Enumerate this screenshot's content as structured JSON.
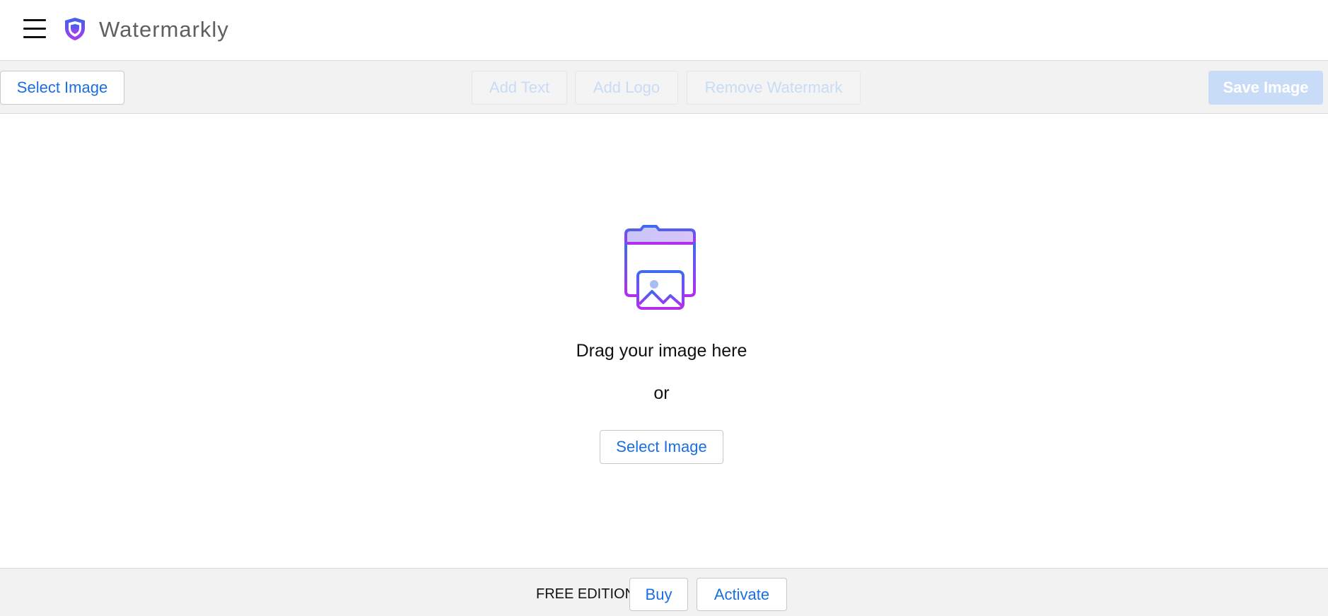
{
  "header": {
    "menu_icon": "hamburger-menu-icon",
    "logo_icon": "shield-logo-icon",
    "app_title": "Watermarkly",
    "colors": {
      "logo_gradient_start": "#4a4ee8",
      "logo_gradient_end": "#a93cf0"
    }
  },
  "toolbar": {
    "select_image_label": "Select Image",
    "add_text_label": "Add Text",
    "add_logo_label": "Add Logo",
    "remove_watermark_label": "Remove Watermark",
    "save_image_label": "Save Image"
  },
  "dropzone": {
    "icon": "folder-image-icon",
    "drag_text": "Drag your image here",
    "or_text": "or",
    "select_image_label": "Select Image"
  },
  "footer": {
    "edition_label": "FREE EDITION",
    "buy_label": "Buy",
    "activate_label": "Activate"
  },
  "colors": {
    "accent": "#1a6fe0",
    "toolbar_bg": "#f2f2f2",
    "disabled_text": "#c8dcf6",
    "save_disabled_bg": "#c9dcf7"
  }
}
